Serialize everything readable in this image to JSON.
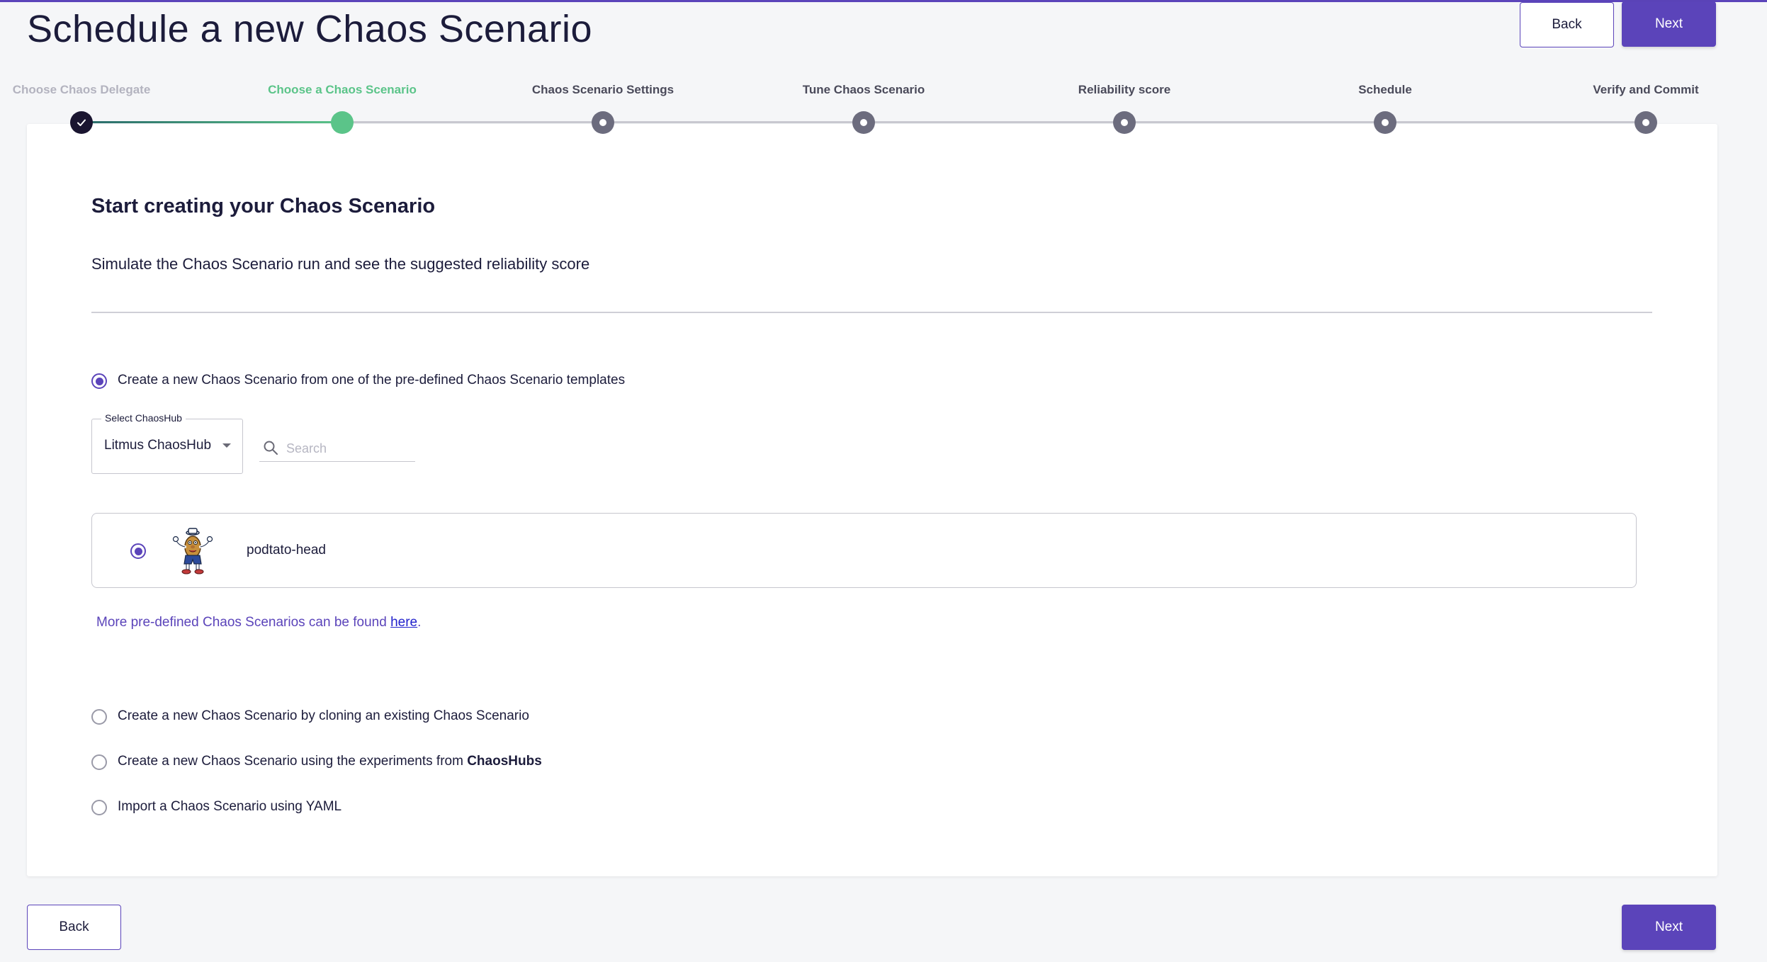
{
  "header": {
    "title": "Schedule a new Chaos Scenario",
    "back_label": "Back",
    "next_label": "Next"
  },
  "stepper": {
    "steps": [
      {
        "label": "Choose Chaos Delegate",
        "state": "done"
      },
      {
        "label": "Choose a Chaos Scenario",
        "state": "active"
      },
      {
        "label": "Chaos Scenario Settings",
        "state": "pending"
      },
      {
        "label": "Tune Chaos Scenario",
        "state": "pending"
      },
      {
        "label": "Reliability score",
        "state": "pending"
      },
      {
        "label": "Schedule",
        "state": "pending"
      },
      {
        "label": "Verify and Commit",
        "state": "pending"
      }
    ]
  },
  "main": {
    "title": "Start creating your Chaos Scenario",
    "subtitle": "Simulate the Chaos Scenario run and see the suggested reliability score",
    "options": {
      "predefined": "Create a new Chaos Scenario from one of the pre-defined Chaos Scenario templates",
      "clone": "Create a new Chaos Scenario by cloning an existing Chaos Scenario",
      "hub_prefix": "Create a new Chaos Scenario using the experiments from ",
      "hub_bold": "ChaosHubs",
      "yaml": "Import a Chaos Scenario using YAML"
    },
    "selected_option": "predefined",
    "chaoshub_select": {
      "label": "Select ChaosHub",
      "value": "Litmus ChaosHub"
    },
    "search": {
      "placeholder": "Search",
      "value": ""
    },
    "templates": [
      {
        "name": "podtato-head",
        "selected": true
      }
    ],
    "more_text": "More pre-defined Chaos Scenarios can be found ",
    "more_link": "here",
    "more_suffix": "."
  },
  "footer": {
    "back_label": "Back",
    "next_label": "Next"
  },
  "colors": {
    "accent": "#5b44ba",
    "success": "#5bc489",
    "link": "#2222cc"
  },
  "icons": [
    "check-icon",
    "search-icon",
    "chevron-down-icon",
    "podtato-head-mascot-icon"
  ]
}
